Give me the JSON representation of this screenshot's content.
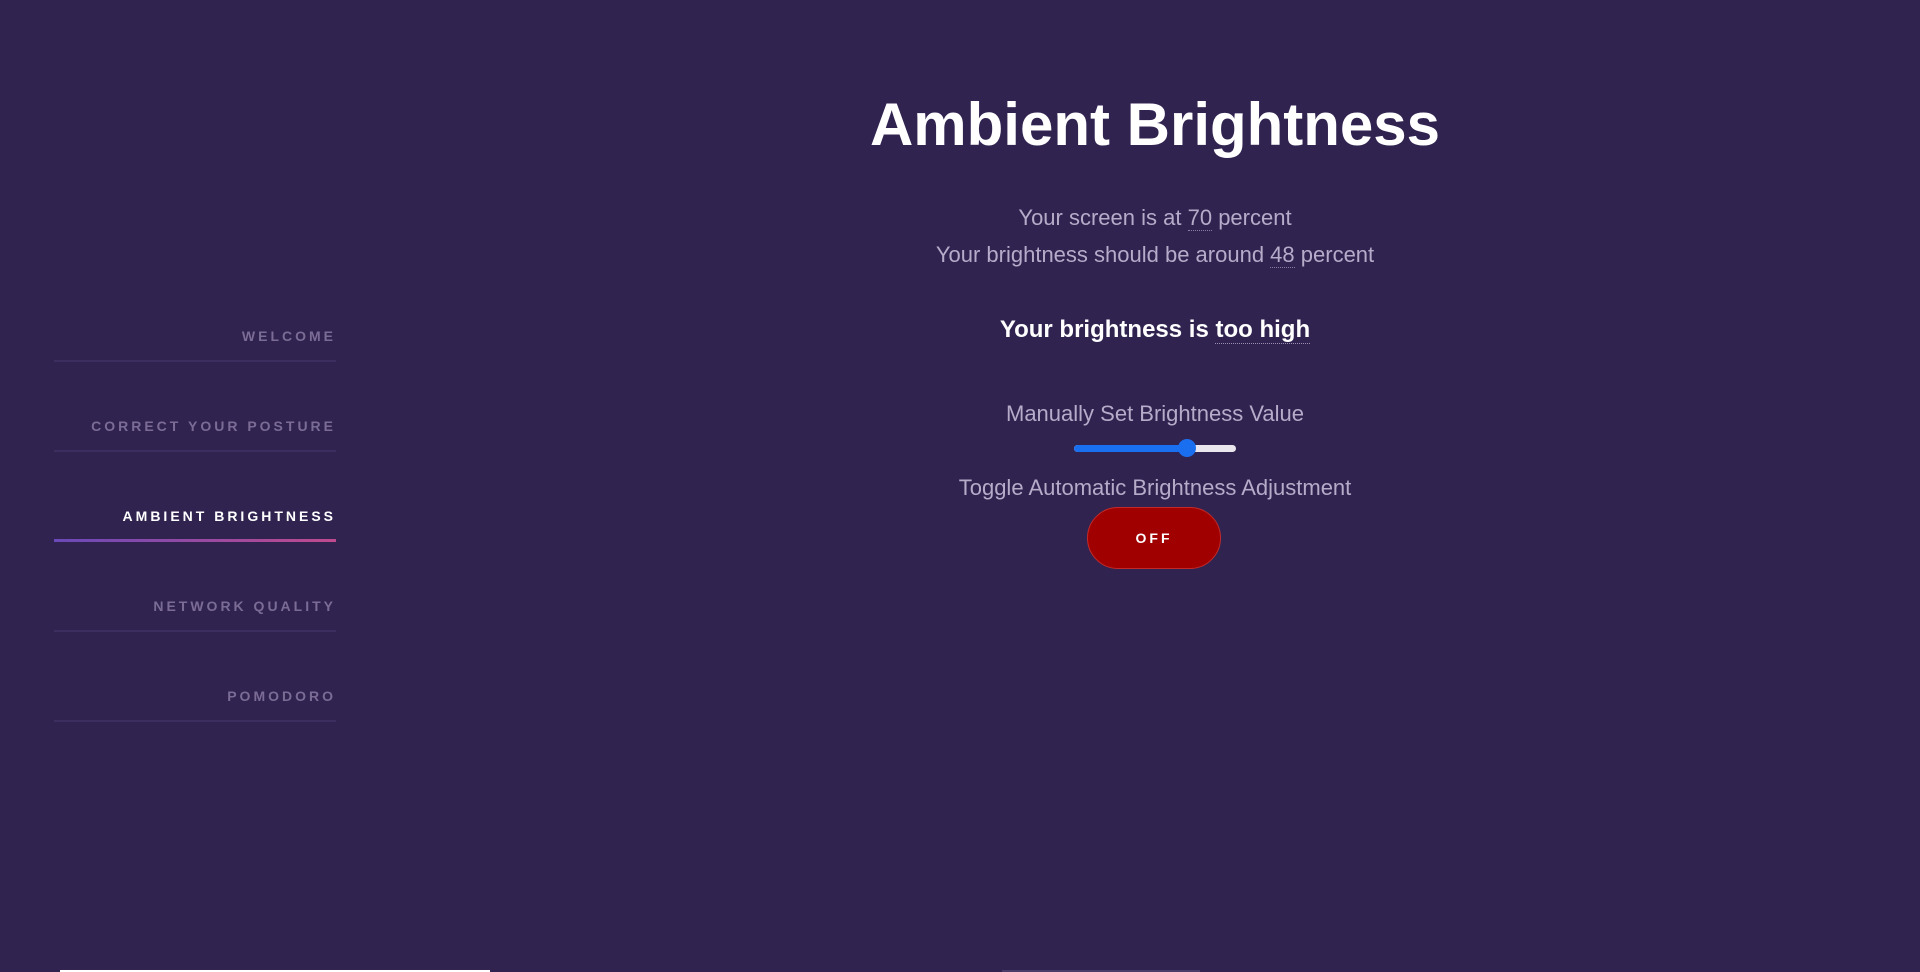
{
  "sidebar": {
    "items": [
      {
        "label": "WELCOME",
        "active": false
      },
      {
        "label": "CORRECT YOUR POSTURE",
        "active": false
      },
      {
        "label": "AMBIENT BRIGHTNESS",
        "active": true
      },
      {
        "label": "NETWORK QUALITY",
        "active": false
      },
      {
        "label": "POMODORO",
        "active": false
      }
    ]
  },
  "main": {
    "title": "Ambient Brightness",
    "screen_line": {
      "prefix": "Your screen is at ",
      "value": "70",
      "suffix": " percent"
    },
    "suggested_line": {
      "prefix": "Your brightness should be around ",
      "value": "48",
      "suffix": " percent"
    },
    "status_line": {
      "prefix": "Your brightness is ",
      "value": "too high"
    },
    "slider": {
      "label": "Manually Set Brightness Value",
      "value": 70,
      "min": 0,
      "max": 100,
      "color": "#1a6ff0"
    },
    "toggle": {
      "label": "Toggle Automatic Brightness Adjustment",
      "state": "OFF",
      "color": "#a00000"
    }
  },
  "theme": {
    "background": "#312350",
    "accent_gradient": [
      "#6a49b8",
      "#c04a8e"
    ]
  }
}
